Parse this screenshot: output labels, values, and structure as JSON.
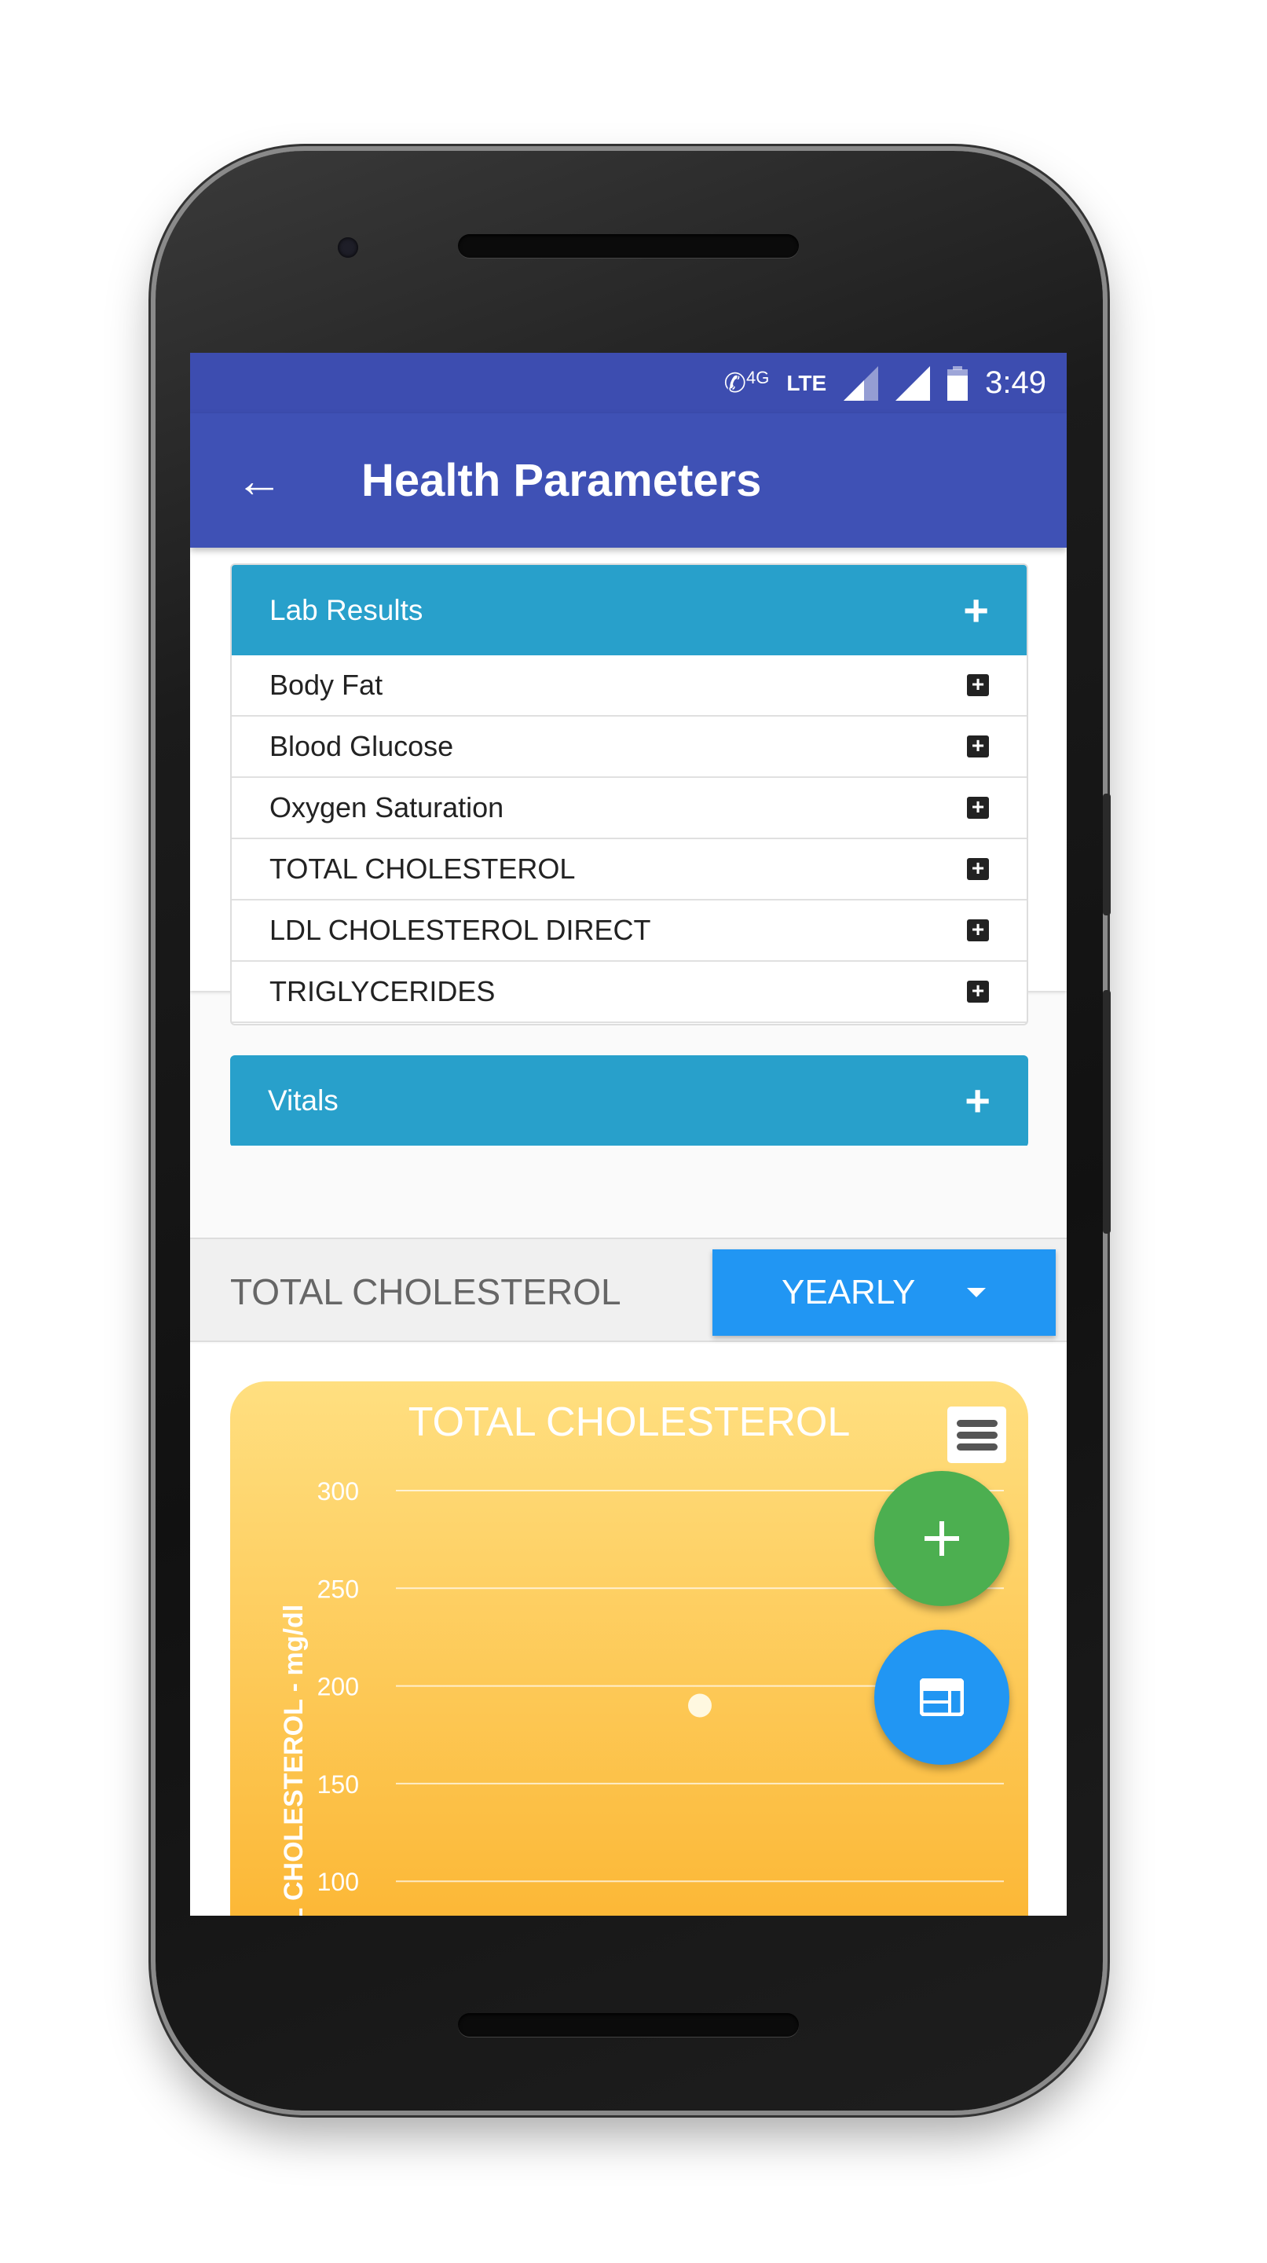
{
  "status_bar": {
    "network_call_label": "4G",
    "network": "LTE",
    "time": "3:49"
  },
  "toolbar": {
    "title": "Health Parameters",
    "back_icon": "arrow-left-icon"
  },
  "accordion": {
    "lab_results": {
      "label": "Lab Results",
      "items": [
        "Body Fat",
        "Blood Glucose",
        "Oxygen Saturation",
        "TOTAL CHOLESTEROL",
        "LDL CHOLESTEROL DIRECT",
        "TRIGLYCERIDES"
      ]
    },
    "vitals": {
      "label": "Vitals"
    }
  },
  "section": {
    "label": "TOTAL CHOLESTEROL",
    "period_select": "YEARLY"
  },
  "colors": {
    "status_bar": "#3d4db0",
    "toolbar": "#3f51b5",
    "accordion_header": "#28a0cb",
    "select": "#2196f3",
    "fab_add": "#4caf50",
    "fab_table": "#2196f3",
    "chart_top": "#ffdf80",
    "chart_bottom": "#fbb12a"
  },
  "chart_data": {
    "type": "scatter",
    "title": "TOTAL CHOLESTEROL",
    "ylabel": "TOTAL CHOLESTEROL - mg/dl",
    "yticks": [
      "300",
      "250",
      "200",
      "150",
      "100"
    ],
    "ylim_visible": [
      100,
      300
    ],
    "grid": true,
    "series": [
      {
        "values": [
          190
        ]
      }
    ]
  }
}
